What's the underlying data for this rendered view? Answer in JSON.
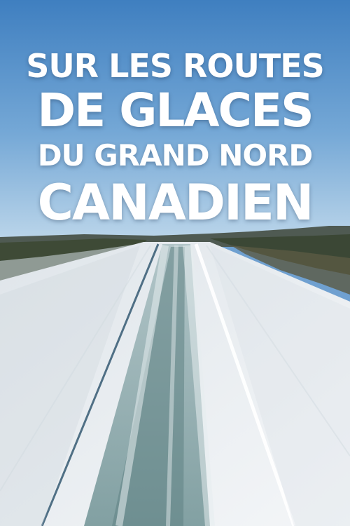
{
  "poster": {
    "title_lines": [
      "SUR LES ROUTES",
      "DE GLACES",
      "DU GRAND NORD",
      "CANADIEN"
    ]
  },
  "colors": {
    "sky_top": "#3f7fc0",
    "sky_bottom": "#bcd6ea",
    "snow": "#eef1f4",
    "ice": "#7e9ea0",
    "treeline": "#3e4a36"
  }
}
